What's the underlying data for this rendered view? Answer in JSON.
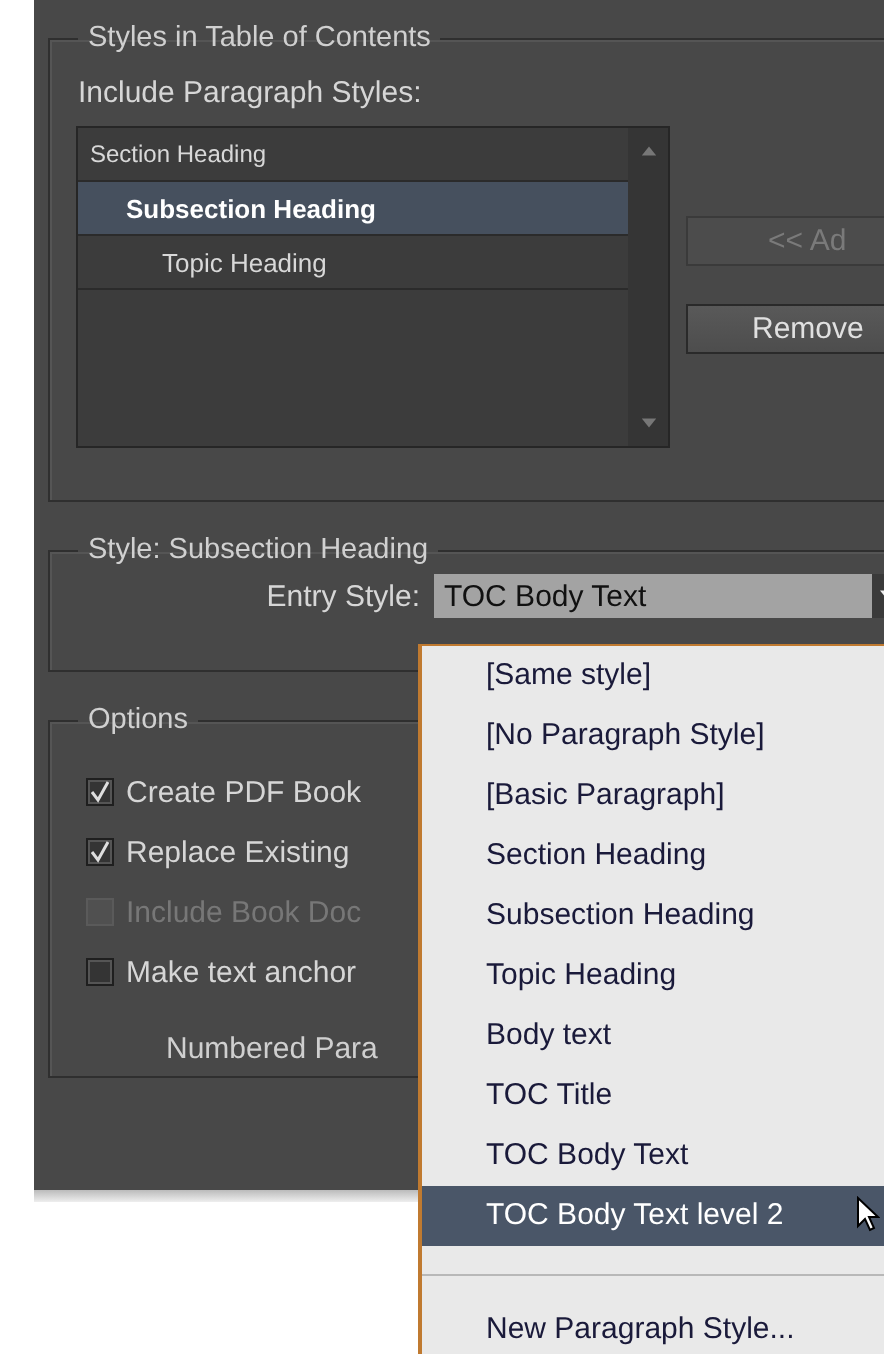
{
  "styles_group": {
    "title": "Styles in Table of Contents",
    "list_label": "Include Paragraph Styles:",
    "styles": [
      {
        "label": "Section Heading",
        "selected": false,
        "children": [
          {
            "label": "Subsection Heading",
            "selected": true,
            "children": [
              {
                "label": "Topic Heading",
                "selected": false
              }
            ]
          }
        ]
      }
    ],
    "buttons": [
      {
        "label": "<< Ad",
        "disabled": true
      },
      {
        "label": "Remove",
        "disabled": false
      }
    ]
  },
  "style_group": {
    "title": "Style: Subsection Heading",
    "entry_style_label": "Entry Style:",
    "entry_style_value": "TOC Body Text"
  },
  "options_group": {
    "title": "Options",
    "checkboxes": [
      {
        "label": "Create PDF Book",
        "checked": true,
        "disabled": false
      },
      {
        "label": "Replace Existing",
        "checked": true,
        "disabled": false
      },
      {
        "label": "Include Book Doc",
        "checked": false,
        "disabled": true
      },
      {
        "label": "Make text anchor",
        "checked": false,
        "disabled": false
      }
    ],
    "numbered_label": "Numbered Para"
  },
  "dropdown_menu": {
    "items": [
      {
        "label": "[Same style]",
        "selected": false
      },
      {
        "label": "[No Paragraph Style]",
        "selected": false
      },
      {
        "label": "[Basic Paragraph]",
        "selected": false
      },
      {
        "label": "Section Heading",
        "selected": false
      },
      {
        "label": "Subsection Heading",
        "selected": false
      },
      {
        "label": "Topic Heading",
        "selected": false
      },
      {
        "label": "Body text",
        "selected": false
      },
      {
        "label": "TOC Title",
        "selected": false
      },
      {
        "label": "TOC Body Text",
        "selected": false
      },
      {
        "label": "TOC Body Text level 2",
        "selected": true
      }
    ],
    "footer_item": "New Paragraph Style..."
  }
}
